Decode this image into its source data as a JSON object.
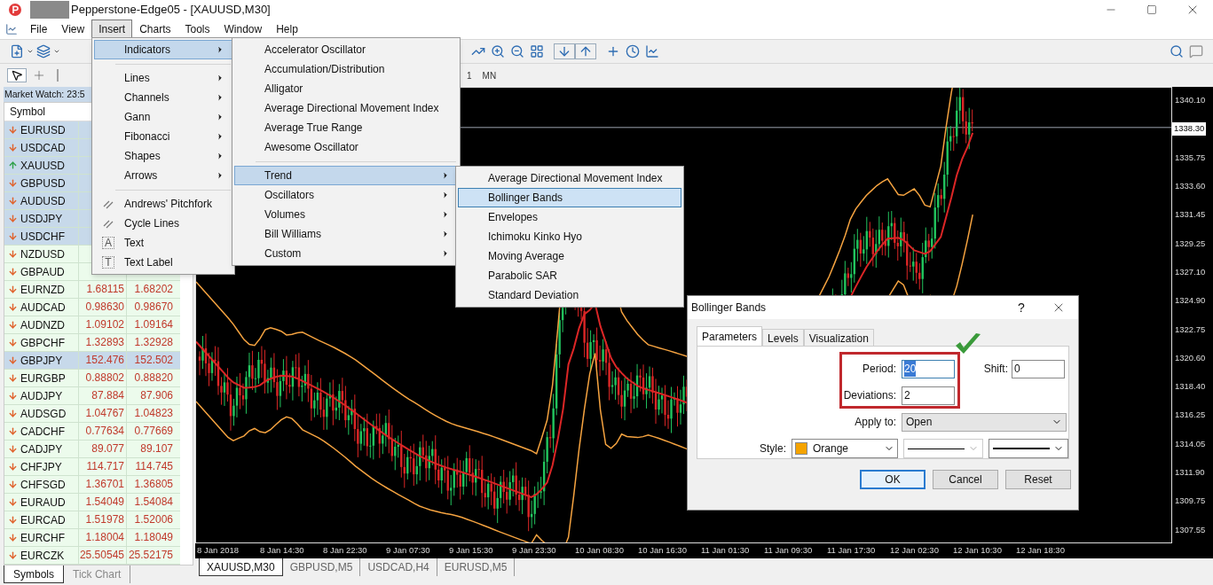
{
  "window": {
    "title": "Pepperstone-Edge05 - [XAUUSD,M30]"
  },
  "menu_bar": [
    {
      "label": "File",
      "selected": false
    },
    {
      "label": "View",
      "selected": false
    },
    {
      "label": "Insert",
      "selected": true
    },
    {
      "label": "Charts",
      "selected": false
    },
    {
      "label": "Tools",
      "selected": false
    },
    {
      "label": "Window",
      "selected": false
    },
    {
      "label": "Help",
      "selected": false
    }
  ],
  "periods": [
    "1",
    "MN"
  ],
  "market_watch": {
    "title": "Market Watch: 23:5",
    "columns": [
      "Symbol"
    ],
    "rows": [
      {
        "symbol": "EURUSD",
        "rising": false,
        "selected": true
      },
      {
        "symbol": "USDCAD",
        "rising": false,
        "selected": true
      },
      {
        "symbol": "XAUUSD",
        "rising": true,
        "selected": true
      },
      {
        "symbol": "GBPUSD",
        "rising": false,
        "selected": true
      },
      {
        "symbol": "AUDUSD",
        "rising": false,
        "selected": true
      },
      {
        "symbol": "USDJPY",
        "rising": false,
        "selected": true
      },
      {
        "symbol": "USDCHF",
        "rising": false,
        "selected": true
      },
      {
        "symbol": "NZDUSD",
        "rising": false,
        "selected": false
      },
      {
        "symbol": "GBPAUD",
        "rising": false,
        "selected": false
      },
      {
        "symbol": "EURNZD",
        "bid": "1.68115",
        "ask": "1.68202",
        "rising": false,
        "selected": false
      },
      {
        "symbol": "AUDCAD",
        "bid": "0.98630",
        "ask": "0.98670",
        "rising": false,
        "selected": false
      },
      {
        "symbol": "AUDNZD",
        "bid": "1.09102",
        "ask": "1.09164",
        "rising": false,
        "selected": false
      },
      {
        "symbol": "GBPCHF",
        "bid": "1.32893",
        "ask": "1.32928",
        "rising": false,
        "selected": false
      },
      {
        "symbol": "GBPJPY",
        "bid": "152.476",
        "ask": "152.502",
        "rising": false,
        "selected": true
      },
      {
        "symbol": "EURGBP",
        "bid": "0.88802",
        "ask": "0.88820",
        "rising": false,
        "selected": false
      },
      {
        "symbol": "AUDJPY",
        "bid": "87.884",
        "ask": "87.906",
        "rising": false,
        "selected": false
      },
      {
        "symbol": "AUDSGD",
        "bid": "1.04767",
        "ask": "1.04823",
        "rising": false,
        "selected": false
      },
      {
        "symbol": "CADCHF",
        "bid": "0.77634",
        "ask": "0.77669",
        "rising": false,
        "selected": false
      },
      {
        "symbol": "CADJPY",
        "bid": "89.077",
        "ask": "89.107",
        "rising": false,
        "selected": false
      },
      {
        "symbol": "CHFJPY",
        "bid": "114.717",
        "ask": "114.745",
        "rising": false,
        "selected": false
      },
      {
        "symbol": "CHFSGD",
        "bid": "1.36701",
        "ask": "1.36805",
        "rising": false,
        "selected": false
      },
      {
        "symbol": "EURAUD",
        "bid": "1.54049",
        "ask": "1.54084",
        "rising": false,
        "selected": false
      },
      {
        "symbol": "EURCAD",
        "bid": "1.51978",
        "ask": "1.52006",
        "rising": false,
        "selected": false
      },
      {
        "symbol": "EURCHF",
        "bid": "1.18004",
        "ask": "1.18049",
        "rising": false,
        "selected": false
      },
      {
        "symbol": "EURCZK",
        "bid": "25.50545",
        "ask": "25.52175",
        "rising": false,
        "selected": false
      }
    ],
    "tabs": [
      {
        "label": "Symbols",
        "selected": true
      },
      {
        "label": "Tick Chart",
        "selected": false
      }
    ]
  },
  "chart": {
    "price_labels": [
      "1340.10",
      "1335.75",
      "1333.60",
      "1331.45",
      "1329.25",
      "1327.10",
      "1324.90",
      "1322.75",
      "1320.60",
      "1318.40",
      "1316.25",
      "1314.05",
      "1311.90",
      "1309.75",
      "1307.55"
    ],
    "current_price": "1338.30",
    "time_labels": [
      "8 Jan 2018",
      "8 Jan 14:30",
      "8 Jan 22:30",
      "9 Jan 07:30",
      "9 Jan 15:30",
      "9 Jan 23:30",
      "10 Jan 08:30",
      "10 Jan 16:30",
      "11 Jan 01:30",
      "11 Jan 09:30",
      "11 Jan 17:30",
      "12 Jan 02:30",
      "12 Jan 10:30",
      "12 Jan 18:30"
    ]
  },
  "chart_tabs": [
    {
      "label": "XAUUSD,M30",
      "selected": true
    },
    {
      "label": "GBPUSD,M5",
      "selected": false
    },
    {
      "label": "USDCAD,H4",
      "selected": false
    },
    {
      "label": "EURUSD,M5",
      "selected": false
    }
  ],
  "insert_menu": [
    {
      "kind": "submenu",
      "label": "Indicators",
      "selected": true
    },
    {
      "kind": "separator"
    },
    {
      "kind": "submenu",
      "label": "Lines",
      "selected": false
    },
    {
      "kind": "submenu",
      "label": "Channels",
      "selected": false
    },
    {
      "kind": "submenu",
      "label": "Gann",
      "selected": false
    },
    {
      "kind": "submenu",
      "label": "Fibonacci",
      "selected": false
    },
    {
      "kind": "submenu",
      "label": "Shapes",
      "selected": false
    },
    {
      "kind": "submenu",
      "label": "Arrows",
      "selected": false
    },
    {
      "kind": "separator"
    },
    {
      "kind": "tool",
      "label": "Andrews' Pitchfork",
      "selected": false
    },
    {
      "kind": "tool",
      "label": "Cycle Lines",
      "selected": false
    },
    {
      "kind": "tool",
      "label": "Text",
      "icon_text": "A",
      "selected": false
    },
    {
      "kind": "tool",
      "label": "Text Label",
      "icon_text": "T",
      "selected": false
    }
  ],
  "indicators_menu": [
    {
      "kind": "item",
      "label": "Accelerator Oscillator",
      "selected": false
    },
    {
      "kind": "item",
      "label": "Accumulation/Distribution",
      "selected": false
    },
    {
      "kind": "item",
      "label": "Alligator",
      "selected": false
    },
    {
      "kind": "item",
      "label": "Average Directional Movement Index",
      "selected": false
    },
    {
      "kind": "item",
      "label": "Average True Range",
      "selected": false
    },
    {
      "kind": "item",
      "label": "Awesome Oscillator",
      "selected": false
    },
    {
      "kind": "separator"
    },
    {
      "kind": "submenu",
      "label": "Trend",
      "selected": true
    },
    {
      "kind": "submenu",
      "label": "Oscillators",
      "selected": false
    },
    {
      "kind": "submenu",
      "label": "Volumes",
      "selected": false
    },
    {
      "kind": "submenu",
      "label": "Bill Williams",
      "selected": false
    },
    {
      "kind": "submenu",
      "label": "Custom",
      "selected": false
    }
  ],
  "trend_menu": [
    {
      "label": "Average Directional Movement Index",
      "selected": false
    },
    {
      "label": "Bollinger Bands",
      "selected": true
    },
    {
      "label": "Envelopes",
      "selected": false
    },
    {
      "label": "Ichimoku Kinko Hyo",
      "selected": false
    },
    {
      "label": "Moving Average",
      "selected": false
    },
    {
      "label": "Parabolic SAR",
      "selected": false
    },
    {
      "label": "Standard Deviation",
      "selected": false
    }
  ],
  "dialog": {
    "title": "Bollinger Bands",
    "help": "?",
    "tabs": [
      {
        "label": "Parameters",
        "selected": true
      },
      {
        "label": "Levels",
        "selected": false
      },
      {
        "label": "Visualization",
        "selected": false
      }
    ],
    "period": {
      "label": "Period:",
      "value": "20",
      "highlighted": true
    },
    "shift": {
      "label": "Shift:",
      "value": "0"
    },
    "deviations": {
      "label": "Deviations:",
      "value": "2"
    },
    "apply_to": {
      "label": "Apply to:",
      "value": "Open"
    },
    "style": {
      "label": "Style:",
      "color_name": "Orange",
      "color": "#f5a300",
      "line_disabled": true
    },
    "buttons": [
      {
        "label": "OK",
        "default": true
      },
      {
        "label": "Cancel",
        "default": false
      },
      {
        "label": "Reset",
        "default": false
      }
    ]
  }
}
